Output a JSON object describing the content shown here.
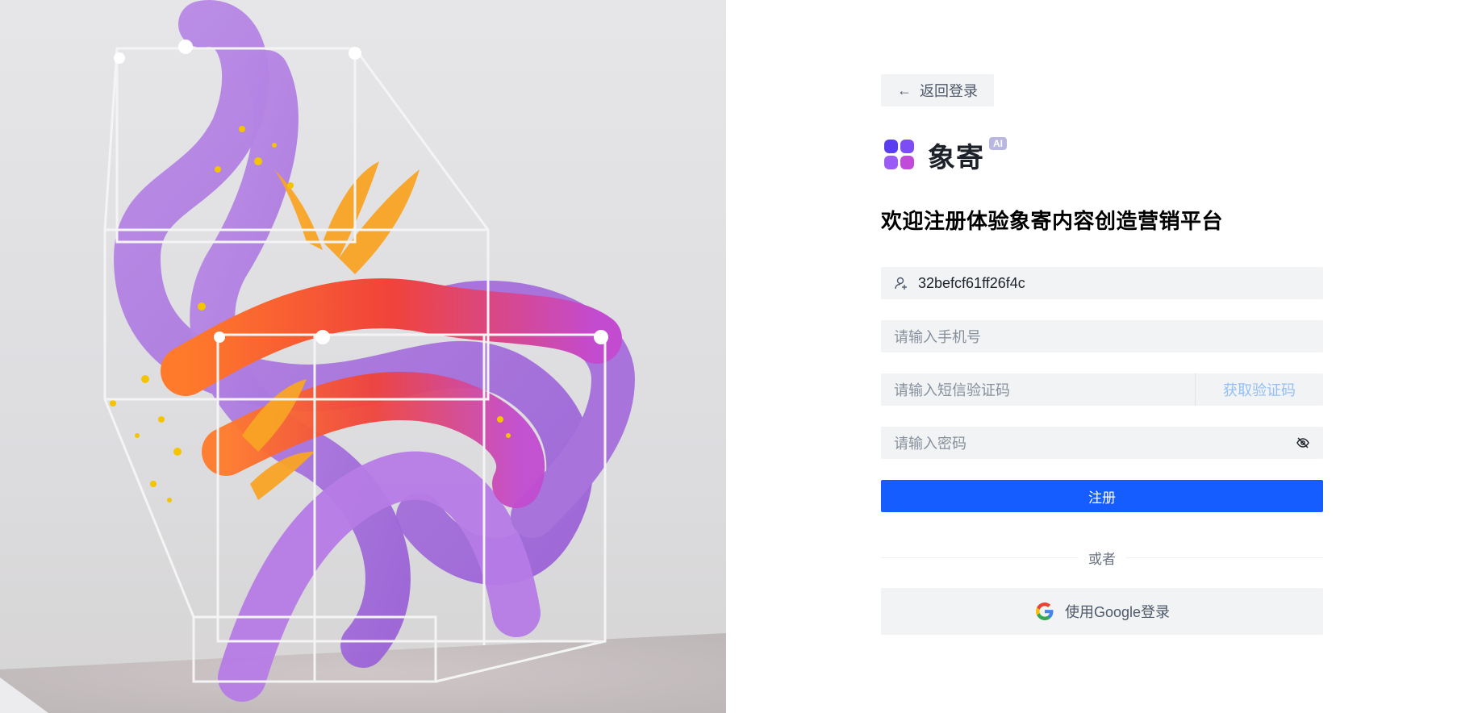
{
  "back_button": {
    "label": "返回登录",
    "icon": "arrow-left-icon"
  },
  "brand": {
    "name": "象寄",
    "badge": "AI"
  },
  "headline": "欢迎注册体验象寄内容创造营销平台",
  "form": {
    "username": {
      "value": "32befcf61ff26f4c",
      "icon": "user-add-icon"
    },
    "phone": {
      "placeholder": "请输入手机号"
    },
    "sms_code": {
      "placeholder": "请输入短信验证码",
      "action_label": "获取验证码"
    },
    "password": {
      "placeholder": "请输入密码",
      "icon": "eye-off-icon"
    },
    "submit_label": "注册"
  },
  "divider_text": "或者",
  "google_button": {
    "label": "使用Google登录",
    "icon": "google-icon"
  },
  "colors": {
    "primary": "#165dff",
    "field_bg": "#f2f3f5",
    "link_disabled": "#94bff5"
  }
}
